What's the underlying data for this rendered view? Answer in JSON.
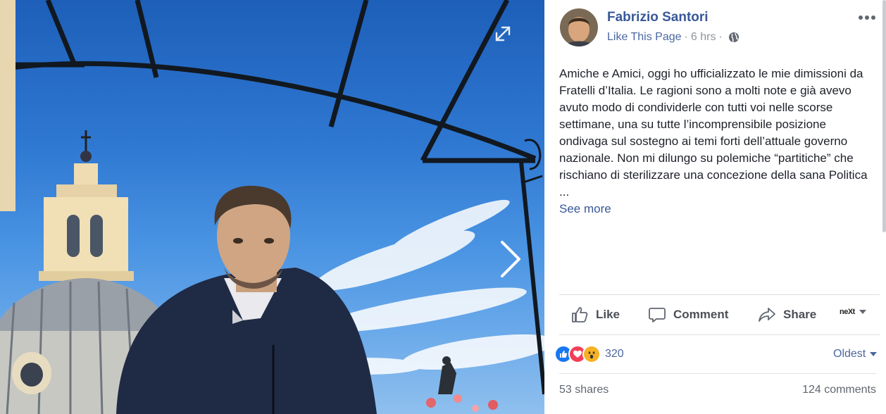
{
  "post": {
    "author": "Fabrizio Santori",
    "like_page": "Like This Page",
    "separator": "·",
    "time": "6 hrs",
    "text": "Amiche e Amici, oggi ho ufficializzato le mie dimissioni da Fratelli d’Italia. Le ragioni sono a molti note e già avevo avuto modo di condividerle con tutti voi nelle scorse settimane, una su tutte l’incomprensibile posizione ondivaga sul sostegno ai temi forti dell’attuale governo nazionale. Non mi dilungo su polemiche “partitiche” che rischiano di sterilizzare una concezione della sana Politica ...",
    "see_more": "See more"
  },
  "actions": {
    "like": "Like",
    "comment": "Comment",
    "share": "Share",
    "page_logo": "neXt"
  },
  "reactions": {
    "types": [
      "like-icon",
      "love-icon",
      "wow-icon"
    ],
    "count": "320",
    "sort": "Oldest"
  },
  "stats": {
    "shares": "53 shares",
    "comments": "124 comments"
  },
  "colors": {
    "link": "#385898",
    "like_blue": "#1877f2",
    "love_red": "#f33e58",
    "wow_yellow": "#f7b125"
  }
}
